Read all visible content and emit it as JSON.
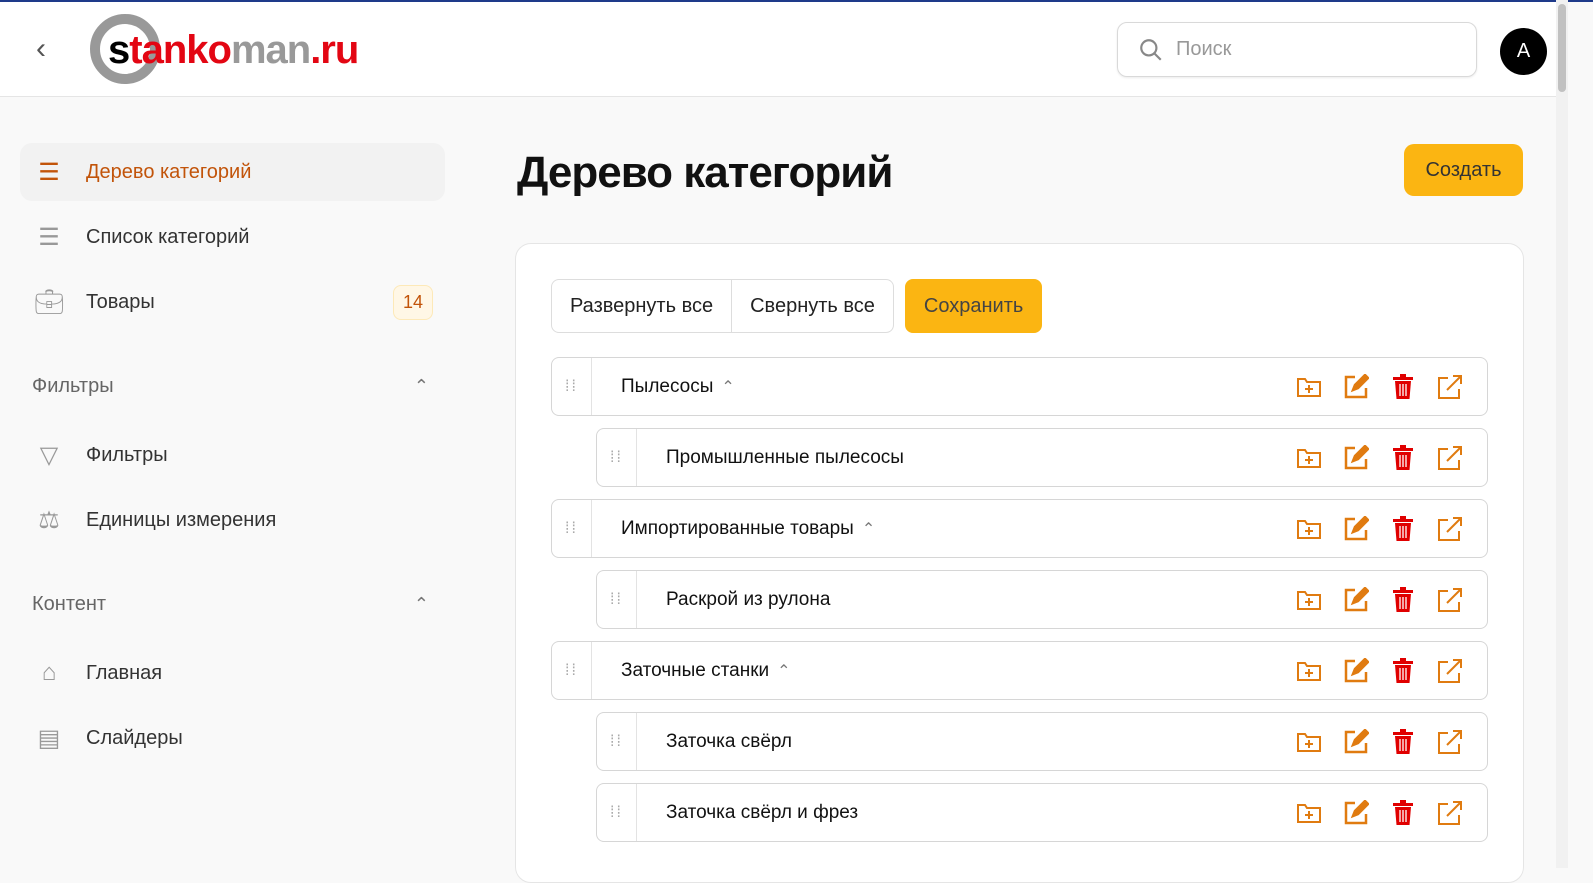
{
  "header": {
    "logo": "stankoman.ru",
    "search_placeholder": "Поиск",
    "avatar": "A"
  },
  "sidebar": {
    "items": [
      {
        "label": "Дерево категорий"
      },
      {
        "label": "Список категорий"
      },
      {
        "label": "Товары",
        "badge": "14"
      }
    ],
    "sections": [
      {
        "title": "Фильтры",
        "items": [
          {
            "label": "Фильтры"
          },
          {
            "label": "Единицы измерения"
          }
        ]
      },
      {
        "title": "Контент",
        "items": [
          {
            "label": "Главная"
          },
          {
            "label": "Слайдеры"
          }
        ]
      }
    ]
  },
  "main": {
    "title": "Дерево категорий",
    "create": "Создать",
    "expand_all": "Развернуть все",
    "collapse_all": "Свернуть все",
    "save": "Сохранить",
    "rows": [
      {
        "name": "Пылесосы",
        "level": 0
      },
      {
        "name": "Промышленные пылесосы",
        "level": 1
      },
      {
        "name": "Импортированные товары",
        "level": 0
      },
      {
        "name": "Раскрой из рулона",
        "level": 1
      },
      {
        "name": "Заточные станки",
        "level": 0
      },
      {
        "name": "Заточка свёрл",
        "level": 1
      },
      {
        "name": "Заточка свёрл и фрез",
        "level": 1
      }
    ]
  },
  "colors": {
    "accent": "#fbb512",
    "active": "#c2540a",
    "icon": "#e07b10",
    "delete": "#e00000"
  }
}
